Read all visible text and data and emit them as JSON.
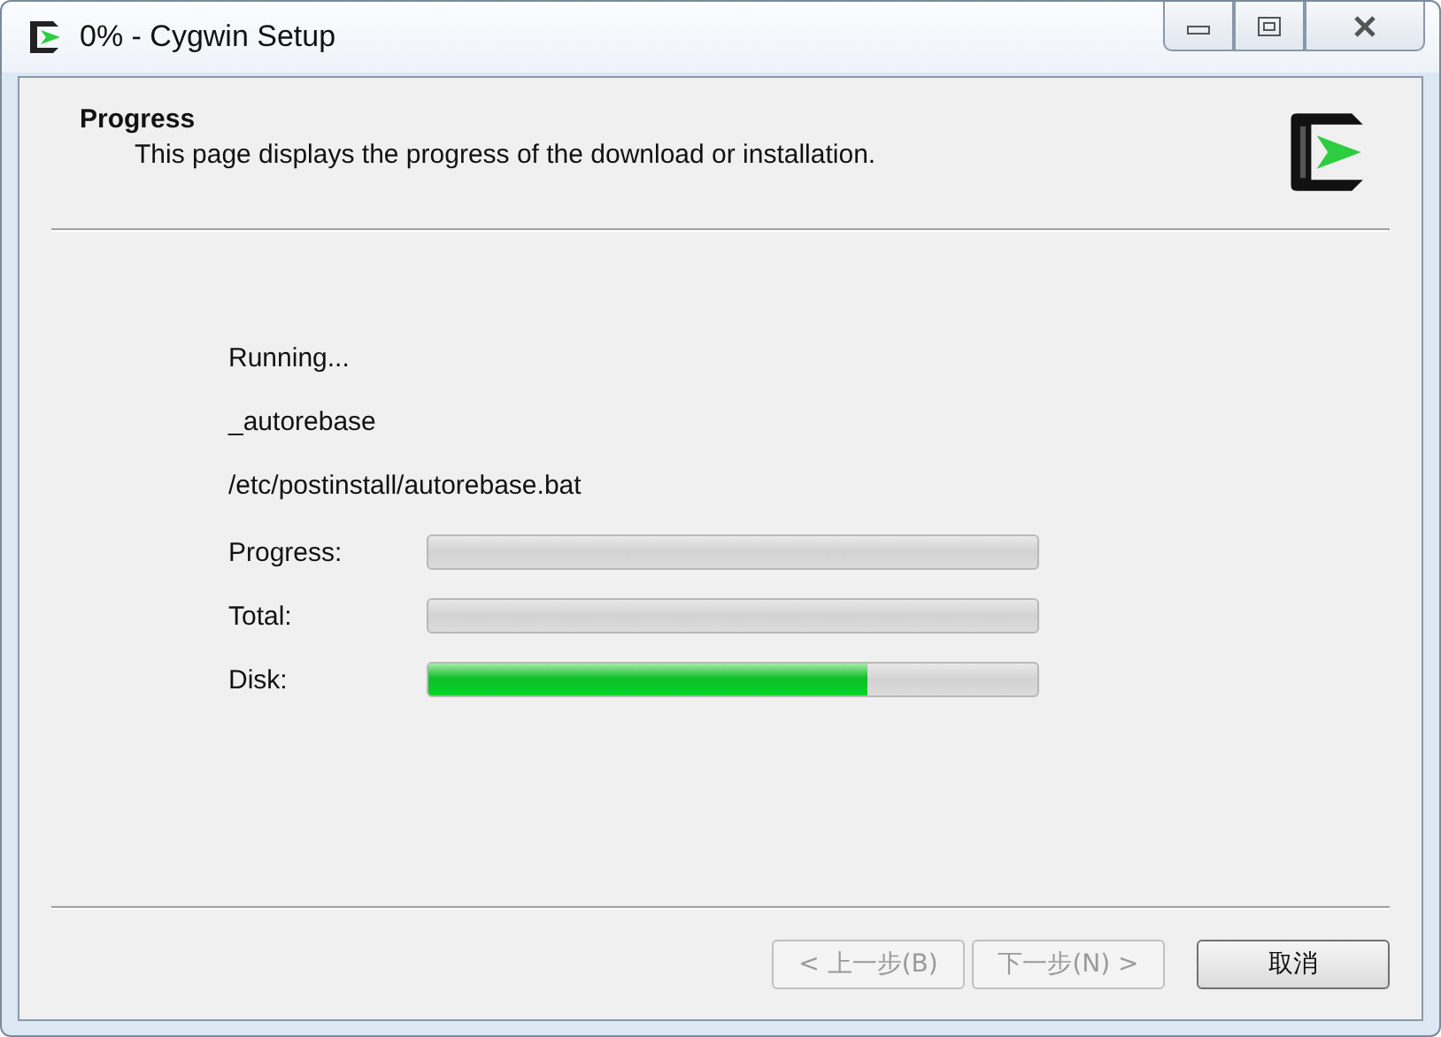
{
  "window": {
    "title": "0% - Cygwin Setup"
  },
  "header": {
    "title": "Progress",
    "subtitle": "This page displays the progress of the download or installation."
  },
  "status_lines": [
    "Running...",
    "_autorebase",
    "/etc/postinstall/autorebase.bat"
  ],
  "meters": [
    {
      "label": "Progress:",
      "level": 0
    },
    {
      "label": "Total:",
      "level": 0
    },
    {
      "label": "Disk:",
      "level": 0.72
    }
  ],
  "buttons": [
    {
      "label": "< 上一步(B)",
      "disabled": true
    },
    {
      "label": "下一步(N) >",
      "disabled": true
    },
    {
      "label": "取消",
      "disabled": false
    }
  ]
}
